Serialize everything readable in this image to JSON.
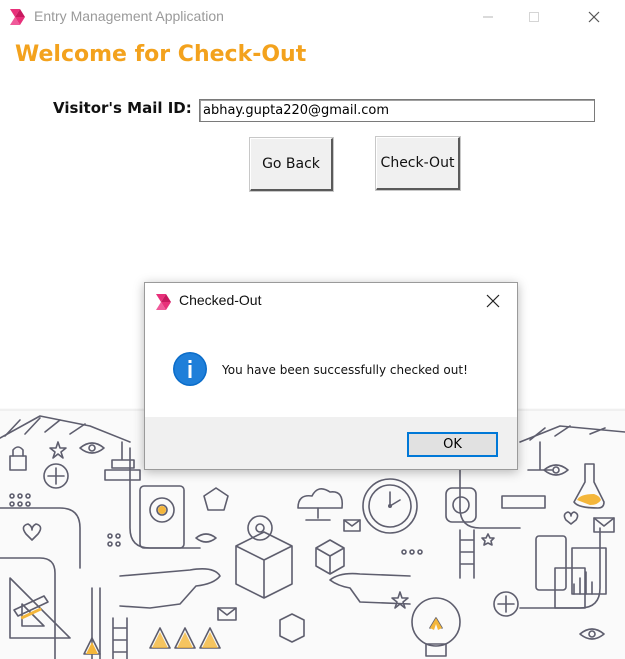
{
  "window": {
    "title": "Entry Management Application",
    "icon": "feather-logo-icon",
    "controls": [
      "minimize-icon",
      "maximize-icon",
      "close-icon"
    ]
  },
  "main": {
    "heading": "Welcome for Check-Out",
    "mail_label": "Visitor's Mail ID:",
    "mail_value": "abhay.gupta220@gmail.com",
    "go_back_label": "Go Back",
    "check_out_label": "Check-Out"
  },
  "dialog": {
    "title": "Checked-Out",
    "icon": "info-icon",
    "message": "You have been successfully checked out!",
    "ok_label": "OK"
  },
  "colors": {
    "heading": "#f3a21d",
    "accent_blue": "#0078d7",
    "logo_pink": "#e8307a"
  }
}
